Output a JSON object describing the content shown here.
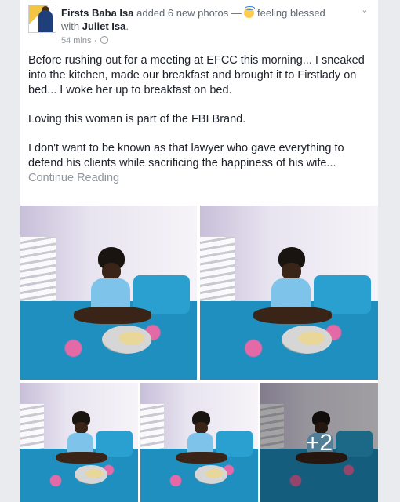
{
  "post": {
    "author": "Firsts Baba Isa",
    "action": " added 6 new photos — ",
    "feeling": " feeling blessed",
    "with_prefix": "with ",
    "tagged": "Juliet Isa",
    "period": ".",
    "time": "54 mins",
    "dot": " · ",
    "paragraphs": [
      "Before rushing out for a meeting at EFCC this morning... I sneaked into the kitchen, made our breakfast and brought it to Firstlady on bed... I woke her up to breakfast on bed.",
      "Loving this woman is part of the FBI Brand.",
      "I don't want to be known as that lawyer who gave everything to defend his clients while sacrificing the happiness of his wife..."
    ],
    "continue_label": "Continue Reading",
    "more_photos": "+2"
  },
  "icons": {
    "feeling": "blessed-emoji-icon",
    "privacy": "globe-icon",
    "menu": "chevron-down-icon"
  },
  "colors": {
    "link": "#1d2129",
    "meta": "#90949c",
    "bed": "#1f8fbf"
  }
}
